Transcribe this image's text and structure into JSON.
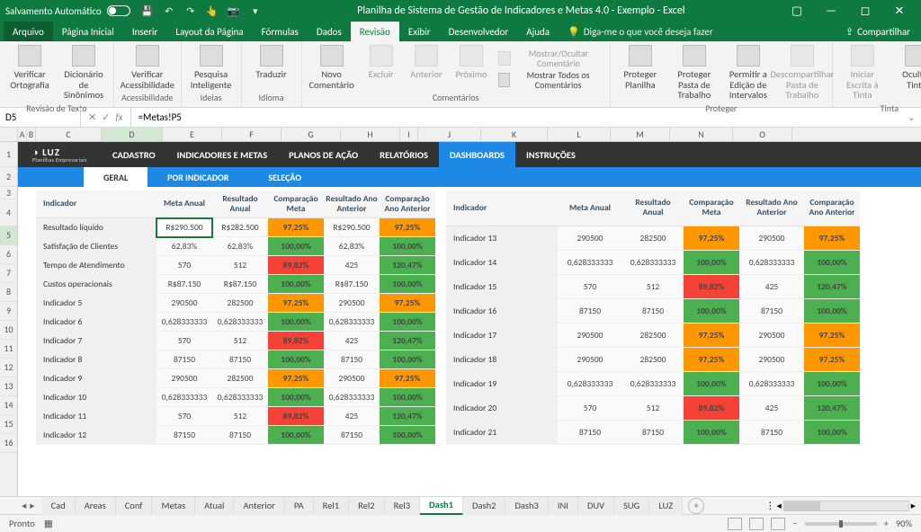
{
  "titlebar": {
    "autosave": "Salvamento Automático",
    "title": "Planilha de Sistema de Gestão de Indicadores e Metas 4.0 - Exemplo  -  Excel"
  },
  "menu": {
    "file": "Arquivo",
    "tabs": [
      "Página Inicial",
      "Inserir",
      "Layout da Página",
      "Fórmulas",
      "Dados",
      "Revisão",
      "Exibir",
      "Desenvolvedor",
      "Ajuda"
    ],
    "active": "Revisão",
    "tellme": "Diga-me o que você deseja fazer",
    "share": "Compartilhar"
  },
  "ribbon": {
    "g1": {
      "lbl": "Revisão de Texto",
      "b": [
        "Verificar Ortografia",
        "Dicionário de Sinônimos"
      ]
    },
    "g2": {
      "lbl": "Acessibilidade",
      "b": [
        "Verificar Acessibilidade"
      ]
    },
    "g3": {
      "lbl": "Ideias",
      "b": [
        "Pesquisa Inteligente"
      ]
    },
    "g4": {
      "lbl": "Idioma",
      "b": [
        "Traduzir"
      ]
    },
    "g5": {
      "lbl": "Comentários",
      "b": [
        "Novo Comentário",
        "Excluir",
        "Anterior",
        "Próximo"
      ],
      "r": [
        "Mostrar/Ocultar Comentário",
        "Mostrar Todos os Comentários"
      ]
    },
    "g6": {
      "lbl": "Proteger",
      "b": [
        "Proteger Planilha",
        "Proteger Pasta de Trabalho",
        "Permitir a Edição de Intervalos",
        "Descompartilhar Pasta de Trabalho"
      ]
    },
    "g7": {
      "lbl": "Tinta",
      "b": [
        "Iniciar Escrita à Tinta",
        "Ocultar Tinta"
      ]
    }
  },
  "fbar": {
    "name": "D5",
    "fx": "fx",
    "formula": "=Metas!P5"
  },
  "cols": [
    "A",
    "B",
    "C",
    "D",
    "E",
    "F",
    "G",
    "H",
    "I",
    "J",
    "K",
    "L",
    "M",
    "N",
    "O"
  ],
  "nav": {
    "logo": "LUZ",
    "logosub": "Planilhas Empresariais",
    "tabs": [
      "CADASTRO",
      "INDICADORES E METAS",
      "PLANOS DE AÇÃO",
      "RELATÓRIOS",
      "DASHBOARDS",
      "INSTRUÇÕES"
    ],
    "active": "DASHBOARDS"
  },
  "subtabs": {
    "items": [
      "GERAL",
      "POR INDICADOR",
      "SELEÇÃO"
    ],
    "active": "GERAL"
  },
  "headers": [
    "Indicador",
    "Meta Anual",
    "Resultado Anual",
    "Comparação Meta",
    "Resultado Ano Anterior",
    "Comparação Ano Anterior"
  ],
  "rows1": [
    {
      "n": "Resultado líquido",
      "m": "R$290.500",
      "r": "R$282.500",
      "cm": "97,25%",
      "ra": "R$290.500",
      "ca": "97,25%",
      "cmC": "y",
      "caC": "y"
    },
    {
      "n": "Satisfação de Clientes",
      "m": "62,83%",
      "r": "62,83%",
      "cm": "100,00%",
      "ra": "62,83%",
      "ca": "100,00%",
      "cmC": "g",
      "caC": "g"
    },
    {
      "n": "Tempo de Atendimento",
      "m": "570",
      "r": "512",
      "cm": "89,82%",
      "ra": "425",
      "ca": "120,47%",
      "cmC": "r",
      "caC": "g"
    },
    {
      "n": "Custos operacionais",
      "m": "R$87.150",
      "r": "R$87.150",
      "cm": "100,00%",
      "ra": "R$87.150",
      "ca": "100,00%",
      "cmC": "g",
      "caC": "g"
    },
    {
      "n": "Indicador 5",
      "m": "290500",
      "r": "282500",
      "cm": "97,25%",
      "ra": "290500",
      "ca": "97,25%",
      "cmC": "y",
      "caC": "y"
    },
    {
      "n": "Indicador 6",
      "m": "0,628333333",
      "r": "0,628333333",
      "cm": "100,00%",
      "ra": "0,628333333",
      "ca": "100,00%",
      "cmC": "g",
      "caC": "g"
    },
    {
      "n": "Indicador 7",
      "m": "570",
      "r": "512",
      "cm": "89,82%",
      "ra": "425",
      "ca": "120,47%",
      "cmC": "r",
      "caC": "g"
    },
    {
      "n": "Indicador 8",
      "m": "87150",
      "r": "87150",
      "cm": "100,00%",
      "ra": "87150",
      "ca": "100,00%",
      "cmC": "g",
      "caC": "g"
    },
    {
      "n": "Indicador 9",
      "m": "290500",
      "r": "282500",
      "cm": "97,25%",
      "ra": "290500",
      "ca": "97,25%",
      "cmC": "y",
      "caC": "y"
    },
    {
      "n": "Indicador 10",
      "m": "0,628333333",
      "r": "0,628333333",
      "cm": "100,00%",
      "ra": "0,628333333",
      "ca": "100,00%",
      "cmC": "g",
      "caC": "g"
    },
    {
      "n": "Indicador 11",
      "m": "570",
      "r": "512",
      "cm": "89,82%",
      "ra": "425",
      "ca": "120,47%",
      "cmC": "r",
      "caC": "g"
    },
    {
      "n": "Indicador 12",
      "m": "87150",
      "r": "87150",
      "cm": "100,00%",
      "ra": "87150",
      "ca": "100,00%",
      "cmC": "g",
      "caC": "g"
    }
  ],
  "rows2": [
    {
      "n": "Indicador 13",
      "m": "290500",
      "r": "282500",
      "cm": "97,25%",
      "ra": "290500",
      "ca": "97,25%",
      "cmC": "y",
      "caC": "y"
    },
    {
      "n": "Indicador 14",
      "m": "0,628333333",
      "r": "0,628333333",
      "cm": "100,00%",
      "ra": "0,628333333",
      "ca": "100,00%",
      "cmC": "g",
      "caC": "g"
    },
    {
      "n": "Indicador 15",
      "m": "570",
      "r": "512",
      "cm": "89,82%",
      "ra": "425",
      "ca": "120,47%",
      "cmC": "r",
      "caC": "g"
    },
    {
      "n": "Indicador 16",
      "m": "87150",
      "r": "87150",
      "cm": "100,00%",
      "ra": "87150",
      "ca": "100,00%",
      "cmC": "g",
      "caC": "g"
    },
    {
      "n": "Indicador 17",
      "m": "290500",
      "r": "282500",
      "cm": "97,25%",
      "ra": "290500",
      "ca": "97,25%",
      "cmC": "y",
      "caC": "y"
    },
    {
      "n": "Indicador 18",
      "m": "290500",
      "r": "282500",
      "cm": "97,25%",
      "ra": "290500",
      "ca": "97,25%",
      "cmC": "y",
      "caC": "y"
    },
    {
      "n": "Indicador 19",
      "m": "0,628333333",
      "r": "0,628333333",
      "cm": "100,00%",
      "ra": "0,628333333",
      "ca": "100,00%",
      "cmC": "g",
      "caC": "g"
    },
    {
      "n": "Indicador 20",
      "m": "570",
      "r": "512",
      "cm": "89,82%",
      "ra": "425",
      "ca": "120,47%",
      "cmC": "r",
      "caC": "g"
    },
    {
      "n": "Indicador 21",
      "m": "87150",
      "r": "87150",
      "cm": "100,00%",
      "ra": "87150",
      "ca": "100,00%",
      "cmC": "g",
      "caC": "g"
    }
  ],
  "sheets": [
    "Cad",
    "Areas",
    "Conf",
    "Metas",
    "Atual",
    "Anterior",
    "PA",
    "Rel1",
    "Rel2",
    "Rel3",
    "Dash1",
    "Dash2",
    "Dash3",
    "INI",
    "DUV",
    "SUG",
    "LUZ"
  ],
  "activeSheet": "Dash1",
  "status": {
    "ready": "Pronto",
    "zoom": "90%"
  }
}
